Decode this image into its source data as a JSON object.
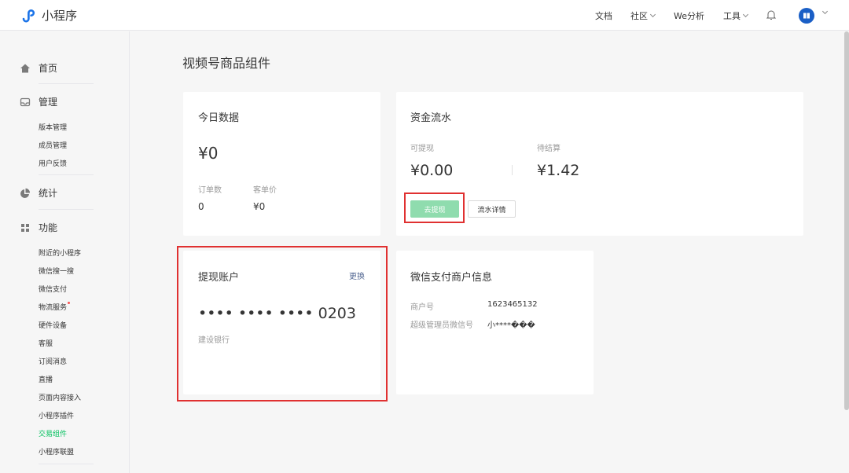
{
  "app": {
    "name": "小程序",
    "brand_color": "#07c160"
  },
  "topnav": {
    "docs": "文档",
    "community": "社区",
    "analytics": "We分析",
    "tools": "工具"
  },
  "sidebar": {
    "home": "首页",
    "manage": {
      "label": "管理",
      "items": [
        "版本管理",
        "成员管理",
        "用户反馈"
      ]
    },
    "stats": "统计",
    "features": {
      "label": "功能",
      "items": [
        "附近的小程序",
        "微信搜一搜",
        "微信支付",
        "物流服务",
        "硬件设备",
        "客服",
        "订阅消息",
        "直播",
        "页面内容接入",
        "小程序插件",
        "交易组件",
        "小程序联盟"
      ],
      "active": "交易组件"
    }
  },
  "page": {
    "title": "视频号商品组件"
  },
  "today": {
    "title": "今日数据",
    "amount": "¥0",
    "orders_label": "订单数",
    "orders_value": "0",
    "avg_label": "客单价",
    "avg_value": "¥0"
  },
  "funds": {
    "title": "资金流水",
    "available_label": "可提现",
    "available_value": "¥0.00",
    "pending_label": "待结算",
    "pending_value": "¥1.42",
    "withdraw_button": "去提现",
    "details_button": "流水详情"
  },
  "account": {
    "title": "提现账户",
    "change_link": "更换",
    "card_number": "•••• •••• •••• 0203",
    "bank": "建设银行"
  },
  "merchant": {
    "title": "微信支付商户信息",
    "id_label": "商户号",
    "id_value": "1623465132",
    "admin_label": "超级管理员微信号",
    "admin_value": "小****���"
  },
  "colors": {
    "highlight": "#e03131",
    "active_nav": "#07c160",
    "button_green": "#8fdcae"
  }
}
